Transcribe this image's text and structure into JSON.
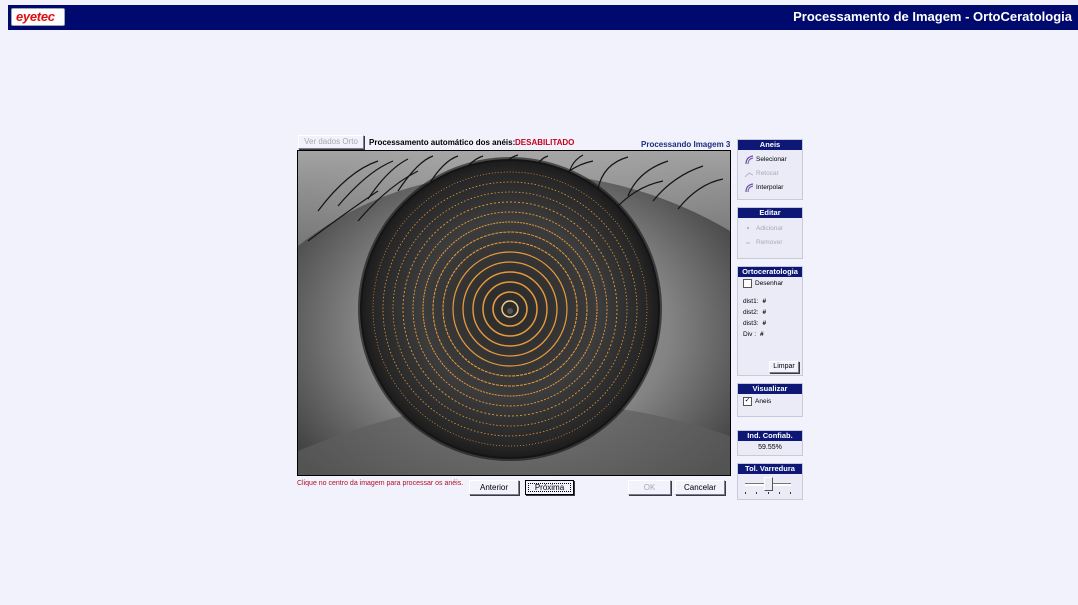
{
  "window": {
    "logo_text": "eyetec",
    "title": "Processamento de Imagem - OrtoCeratologia"
  },
  "toolbar": {
    "ver_dados_label": "Ver dados Orto",
    "auto_label": "Processamento automático dos anéis:",
    "auto_status": "DESABILITADO",
    "processing_label": "Processando Imagem 3"
  },
  "footer": {
    "hint": "Clique no centro da imagem para processar os anéis.",
    "anterior_label": "Anterior",
    "proxima_label": "Próxima",
    "ok_label": "OK",
    "cancelar_label": "Cancelar"
  },
  "side": {
    "aneis": {
      "title": "Aneis",
      "selecionar": "Selecionar",
      "retocar": "Retocar",
      "interpolar": "Interpolar"
    },
    "editar": {
      "title": "Editar",
      "adicionar": "Adicionar",
      "remover": "Remover"
    },
    "orto": {
      "title": "Ortoceratologia",
      "desenhar": "Desenhar",
      "desenhar_checked": false,
      "dist1_label": "dist1:",
      "dist1_value": "#",
      "dist2_label": "dist2:",
      "dist2_value": "#",
      "dist3_label": "dist3:",
      "dist3_value": "#",
      "div_label": "Div :",
      "div_value": "#",
      "limpar": "Limpar"
    },
    "visualizar": {
      "title": "Visualizar",
      "aneis": "Aneis",
      "aneis_checked": true
    },
    "confiab": {
      "title": "Ind. Confiab.",
      "value": "59.55%"
    },
    "varredura": {
      "title": "Tol. Varredura",
      "level": 0.5
    }
  },
  "colors": {
    "titlebar": "#000a6e",
    "panel_header": "#0d1776",
    "status_red": "#c4001d",
    "ring_orange": "#e79a3c"
  }
}
